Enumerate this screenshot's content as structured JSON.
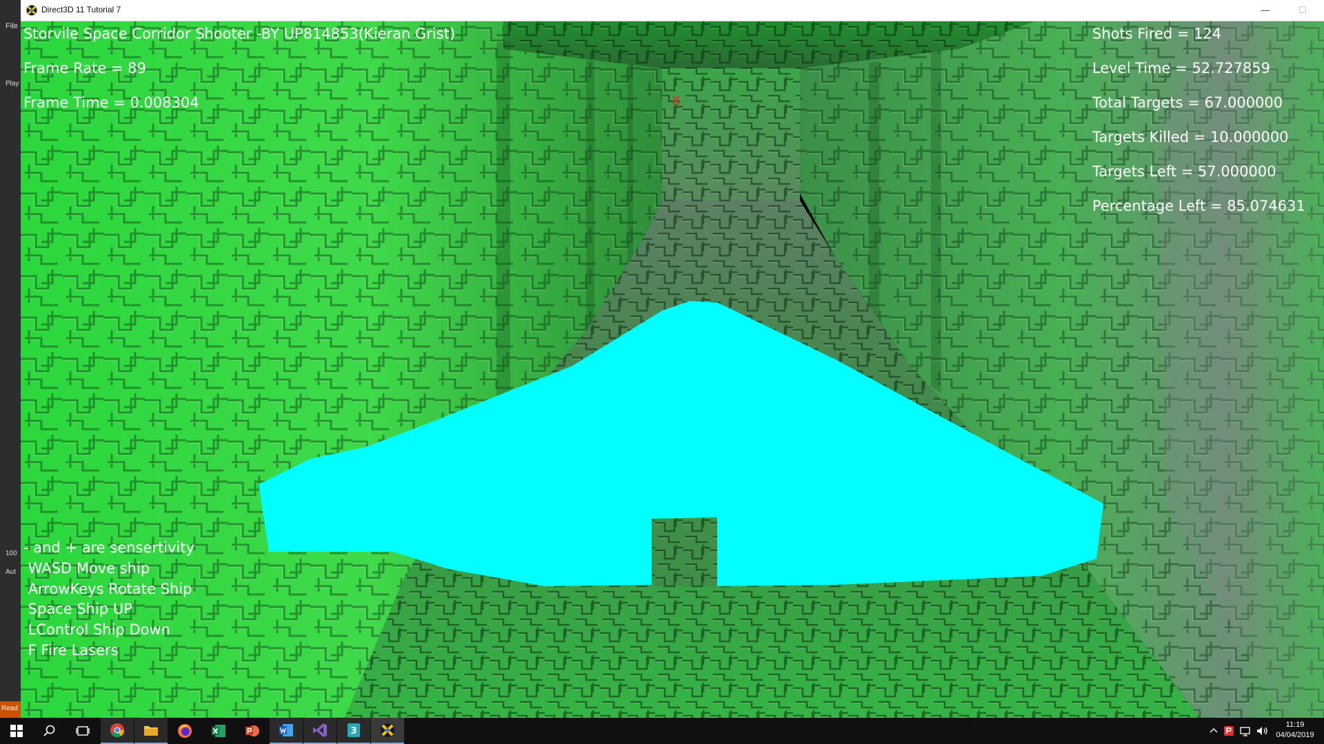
{
  "window": {
    "title": "Direct3D 11 Tutorial 7",
    "minimize_glyph": "—",
    "maximize_glyph": "☐"
  },
  "ide": {
    "menu_file": "File",
    "play_label": "Play",
    "zoom": "100",
    "auto_label": "Aut",
    "status": "Read"
  },
  "hud": {
    "title": "Storvile Space Corridor Shooter -BY UP814853(Kieran Grist)",
    "frame_rate": "Frame Rate = 89",
    "frame_time": "Frame Time = 0.008304",
    "shots_fired": "Shots Fired = 124",
    "level_time": "Level Time = 52.727859",
    "total_targets": "Total Targets = 67.000000",
    "targets_killed": "Targets Killed = 10.000000",
    "targets_left": "Targets Left = 57.000000",
    "percentage_left": "Percentage Left = 85.074631",
    "crosshair": "X"
  },
  "controls": [
    "- and + are sensertivity",
    " WASD Move ship",
    " ArrowKeys Rotate Ship",
    " Space Ship UP",
    " LControl Ship Down",
    " F Fire Lasers"
  ],
  "scene": {
    "wall_color_bright": "#3ddc4f",
    "wall_color_dark": "#1f6b2a",
    "floor_color": "#2f7a3a",
    "ship_color": "#00ffff"
  },
  "taskbar": {
    "icons": [
      "windows-start-icon",
      "search-icon",
      "task-view-icon",
      "chrome-icon",
      "file-explorer-icon",
      "firefox-icon",
      "excel-icon",
      "powerpoint-icon",
      "word-icon",
      "visual-studio-icon",
      "app-3-icon",
      "directx-app-icon"
    ],
    "time": "11:19",
    "date": "04/04/2019"
  }
}
